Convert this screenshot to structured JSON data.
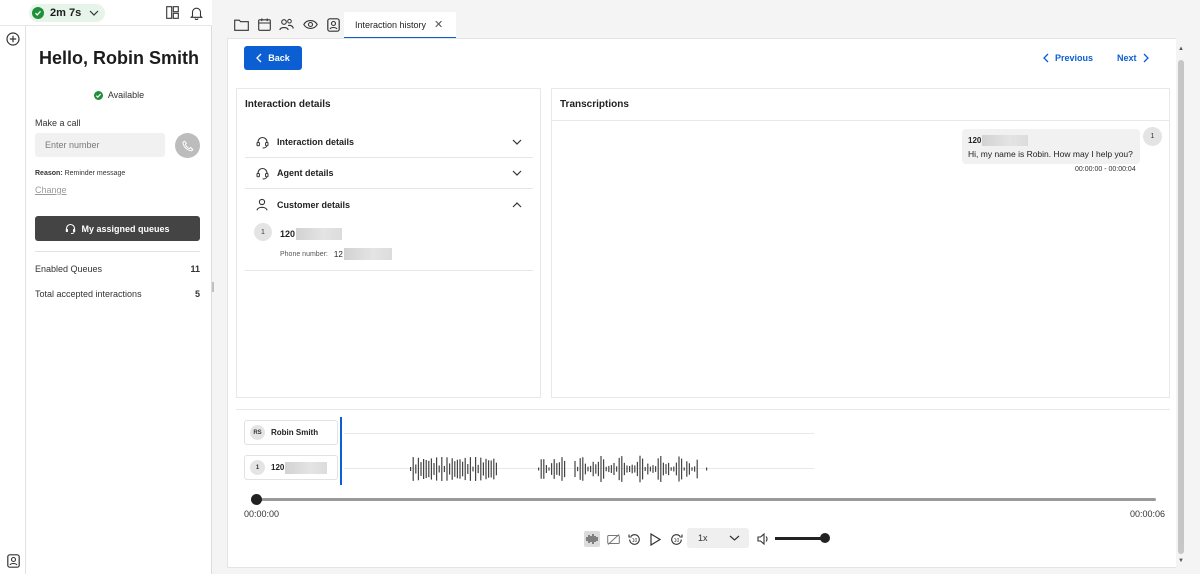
{
  "topbar": {
    "timer": "2m 7s"
  },
  "agent": {
    "greeting": "Hello, Robin Smith",
    "status": "Available",
    "make_call_label": "Make a call",
    "number_placeholder": "Enter number",
    "reason_label": "Reason:",
    "reason_value": "Reminder message",
    "change_link": "Change",
    "queues_button": "My assigned queues",
    "stats": [
      {
        "label": "Enabled Queues",
        "value": "11"
      },
      {
        "label": "Total accepted interactions",
        "value": "5"
      }
    ]
  },
  "tabs": {
    "active_label": "Interaction history"
  },
  "toolbar": {
    "back_label": "Back",
    "previous_label": "Previous",
    "next_label": "Next"
  },
  "interaction_details": {
    "title": "Interaction details",
    "sections": [
      {
        "label": "Interaction details"
      },
      {
        "label": "Agent details"
      },
      {
        "label": "Customer details"
      }
    ],
    "customer": {
      "avatar": "1",
      "name_prefix": "120",
      "phone_label": "Phone number:",
      "phone_prefix": "12"
    }
  },
  "transcriptions": {
    "title": "Transcriptions",
    "message": {
      "avatar": "1",
      "sender_prefix": "120",
      "text": "Hi, my name is Robin. How may I help you?",
      "time_range": "00:00:00 - 00:00:04"
    }
  },
  "player": {
    "tracks": [
      {
        "avatar": "RS",
        "name": "Robin Smith"
      },
      {
        "avatar": "1",
        "name": "120"
      }
    ],
    "progress": 0.0,
    "current_time": "00:00:00",
    "total_time": "00:00:06",
    "speed": "1x",
    "volume": 1.0
  },
  "colors": {
    "accent": "#0b5fd3",
    "available": "#1f8f3a",
    "dark_button": "#444444"
  }
}
